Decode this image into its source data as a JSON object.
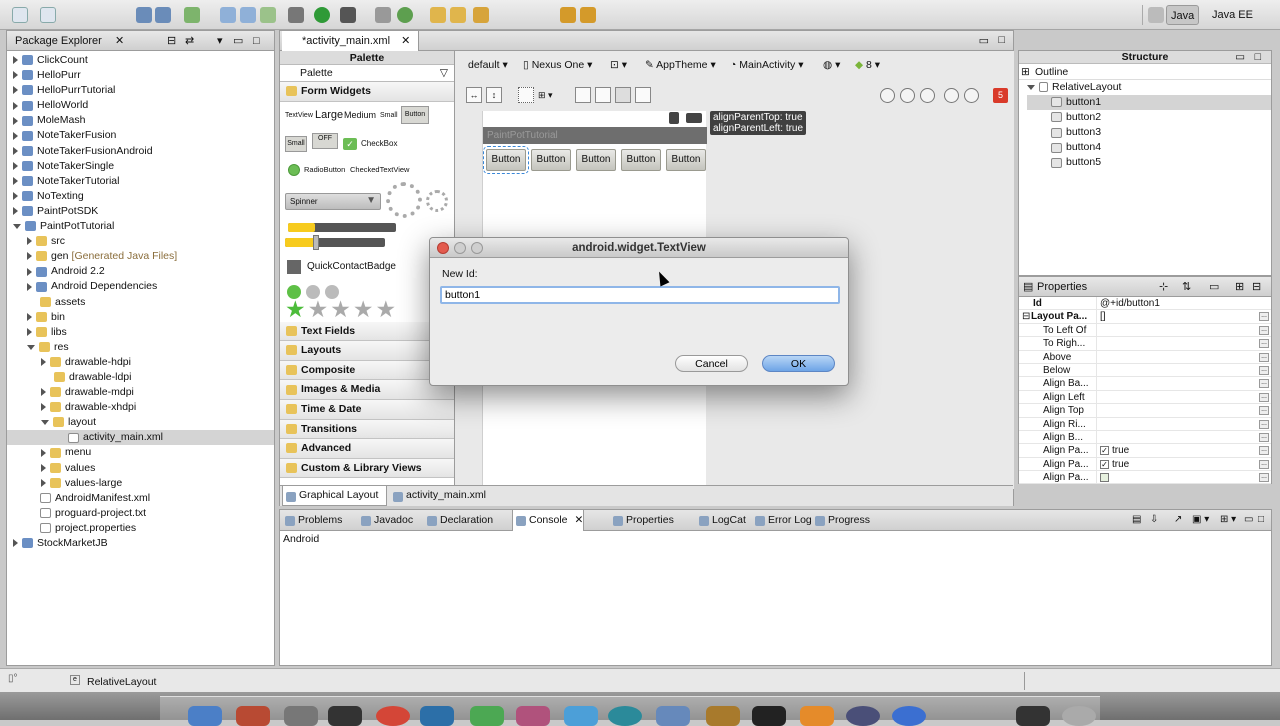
{
  "perspectives": [
    "Java",
    "Java EE"
  ],
  "package_explorer": {
    "title": "Package Explorer",
    "items": [
      {
        "label": "ClickCount",
        "depth": 0,
        "toggle": "closed",
        "icon": "project"
      },
      {
        "label": "HelloPurr",
        "depth": 0,
        "toggle": "closed",
        "icon": "project"
      },
      {
        "label": "HelloPurrTutorial",
        "depth": 0,
        "toggle": "closed",
        "icon": "project"
      },
      {
        "label": "HelloWorld",
        "depth": 0,
        "toggle": "closed",
        "icon": "project"
      },
      {
        "label": "MoleMash",
        "depth": 0,
        "toggle": "closed",
        "icon": "project"
      },
      {
        "label": "NoteTakerFusion",
        "depth": 0,
        "toggle": "closed",
        "icon": "project"
      },
      {
        "label": "NoteTakerFusionAndroid",
        "depth": 0,
        "toggle": "closed",
        "icon": "project"
      },
      {
        "label": "NoteTakerSingle",
        "depth": 0,
        "toggle": "closed",
        "icon": "project"
      },
      {
        "label": "NoteTakerTutorial",
        "depth": 0,
        "toggle": "closed",
        "icon": "project"
      },
      {
        "label": "NoTexting",
        "depth": 0,
        "toggle": "closed",
        "icon": "project"
      },
      {
        "label": "PaintPotSDK",
        "depth": 0,
        "toggle": "closed",
        "icon": "project"
      },
      {
        "label": "PaintPotTutorial",
        "depth": 0,
        "toggle": "open",
        "icon": "project"
      },
      {
        "label": "src",
        "depth": 1,
        "toggle": "closed",
        "icon": "folder"
      },
      {
        "label": "gen",
        "suffix": "[Generated Java Files]",
        "depth": 1,
        "toggle": "closed",
        "icon": "folder"
      },
      {
        "label": "Android 2.2",
        "depth": 1,
        "toggle": "closed",
        "icon": "lib"
      },
      {
        "label": "Android Dependencies",
        "depth": 1,
        "toggle": "closed",
        "icon": "lib"
      },
      {
        "label": "assets",
        "depth": 1,
        "toggle": "none",
        "icon": "folder"
      },
      {
        "label": "bin",
        "depth": 1,
        "toggle": "closed",
        "icon": "folder"
      },
      {
        "label": "libs",
        "depth": 1,
        "toggle": "closed",
        "icon": "folder"
      },
      {
        "label": "res",
        "depth": 1,
        "toggle": "open",
        "icon": "folder"
      },
      {
        "label": "drawable-hdpi",
        "depth": 2,
        "toggle": "closed",
        "icon": "folder"
      },
      {
        "label": "drawable-ldpi",
        "depth": 2,
        "toggle": "none",
        "icon": "folder"
      },
      {
        "label": "drawable-mdpi",
        "depth": 2,
        "toggle": "closed",
        "icon": "folder"
      },
      {
        "label": "drawable-xhdpi",
        "depth": 2,
        "toggle": "closed",
        "icon": "folder"
      },
      {
        "label": "layout",
        "depth": 2,
        "toggle": "open",
        "icon": "folder"
      },
      {
        "label": "activity_main.xml",
        "depth": 3,
        "toggle": "none",
        "icon": "file",
        "selected": true
      },
      {
        "label": "menu",
        "depth": 2,
        "toggle": "closed",
        "icon": "folder"
      },
      {
        "label": "values",
        "depth": 2,
        "toggle": "closed",
        "icon": "folder"
      },
      {
        "label": "values-large",
        "depth": 2,
        "toggle": "closed",
        "icon": "folder"
      },
      {
        "label": "AndroidManifest.xml",
        "depth": 1,
        "toggle": "none",
        "icon": "file"
      },
      {
        "label": "proguard-project.txt",
        "depth": 1,
        "toggle": "none",
        "icon": "file"
      },
      {
        "label": "project.properties",
        "depth": 1,
        "toggle": "none",
        "icon": "file"
      },
      {
        "label": "StockMarketJB",
        "depth": 0,
        "toggle": "closed",
        "icon": "project"
      }
    ]
  },
  "editor": {
    "tab": "*activity_main.xml",
    "palette_title": "Palette",
    "palette_header": "Palette",
    "config": {
      "theme_device": "default",
      "device": "Nexus One",
      "theme": "AppTheme",
      "activity": "MainActivity",
      "api": "8"
    },
    "form_widgets_label": "Form Widgets",
    "widget_labels": {
      "textview": "TextView",
      "large": "Large",
      "medium": "Medium",
      "small": "Small",
      "button": "Button",
      "small_btn": "Small",
      "off": "OFF",
      "checkbox": "CheckBox",
      "radiobutton": "RadioButton",
      "checkedtextview": "CheckedTextView",
      "spinner": "Spinner",
      "quickcontactbadge": "QuickContactBadge"
    },
    "palette_categories": [
      "Text Fields",
      "Layouts",
      "Composite",
      "Images & Media",
      "Time & Date",
      "Transitions",
      "Advanced",
      "Custom & Library Views"
    ],
    "canvas": {
      "app_title": "PaintPotTutorial",
      "buttons": [
        "Button",
        "Button",
        "Button",
        "Button",
        "Button"
      ],
      "hint_lines": [
        "alignParentTop: true",
        "alignParentLeft: true"
      ]
    },
    "bottom_tabs": [
      "Graphical Layout",
      "activity_main.xml"
    ],
    "error_badge": "5"
  },
  "dialog": {
    "title": "android.widget.TextView",
    "field_label": "New Id:",
    "field_value": "button1",
    "cancel_label": "Cancel",
    "ok_label": "OK"
  },
  "structure": {
    "title": "Structure",
    "outline_label": "Outline",
    "root": "RelativeLayout",
    "children": [
      "button1",
      "button2",
      "button3",
      "button4",
      "button5"
    ]
  },
  "properties": {
    "title": "Properties",
    "rows": [
      {
        "key": "Id",
        "value": "@+id/button1",
        "bold": true,
        "indent": 0
      },
      {
        "key": "Layout Pa...",
        "value": "[]",
        "bold": true,
        "indent": 0,
        "group": true
      },
      {
        "key": "To Left Of",
        "value": "",
        "indent": 1
      },
      {
        "key": "To Righ...",
        "value": "",
        "indent": 1
      },
      {
        "key": "Above",
        "value": "",
        "indent": 1
      },
      {
        "key": "Below",
        "value": "",
        "indent": 1
      },
      {
        "key": "Align Ba...",
        "value": "",
        "indent": 1
      },
      {
        "key": "Align Left",
        "value": "",
        "indent": 1
      },
      {
        "key": "Align Top",
        "value": "",
        "indent": 1
      },
      {
        "key": "Align Ri...",
        "value": "",
        "indent": 1
      },
      {
        "key": "Align B...",
        "value": "",
        "indent": 1
      },
      {
        "key": "Align Pa...",
        "value": "true",
        "indent": 1,
        "check": true
      },
      {
        "key": "Align Pa...",
        "value": "true",
        "indent": 1,
        "check": true
      },
      {
        "key": "Align Pa...",
        "value": "",
        "indent": 1,
        "check": false
      }
    ]
  },
  "console": {
    "tabs": [
      "Problems",
      "Javadoc",
      "Declaration",
      "Console",
      "Properties",
      "LogCat",
      "Error Log",
      "Progress"
    ],
    "active_tab": "Console",
    "content_line": "Android"
  },
  "status_bar": {
    "text": "RelativeLayout"
  }
}
